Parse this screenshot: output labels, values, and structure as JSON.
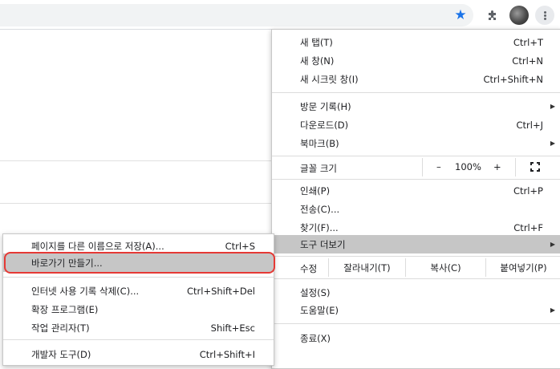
{
  "toolbar": {
    "star_icon": "star-icon",
    "extensions_icon": "puzzle-icon",
    "profile_icon": "avatar",
    "menu_icon": "kebab-menu-icon",
    "accent_color": "#1a73e8"
  },
  "main_menu": {
    "new_tab": {
      "label": "새 탭(T)",
      "shortcut": "Ctrl+T"
    },
    "new_window": {
      "label": "새 창(N)",
      "shortcut": "Ctrl+N"
    },
    "new_incognito": {
      "label": "새 시크릿 창(I)",
      "shortcut": "Ctrl+Shift+N"
    },
    "history": {
      "label": "방문 기록(H)"
    },
    "downloads": {
      "label": "다운로드(D)",
      "shortcut": "Ctrl+J"
    },
    "bookmarks": {
      "label": "북마크(B)"
    },
    "zoom": {
      "label": "글꼴 크기",
      "minus": "–",
      "value": "100%",
      "plus": "+"
    },
    "print": {
      "label": "인쇄(P)",
      "shortcut": "Ctrl+P"
    },
    "cast": {
      "label": "전송(C)..."
    },
    "find": {
      "label": "찾기(F)...",
      "shortcut": "Ctrl+F"
    },
    "more_tools": {
      "label": "도구 더보기"
    },
    "edit": {
      "label": "수정",
      "cut": "잘라내기(T)",
      "copy": "복사(C)",
      "paste": "붙여넣기(P)"
    },
    "settings": {
      "label": "설정(S)"
    },
    "help": {
      "label": "도움말(E)"
    },
    "exit": {
      "label": "종료(X)"
    }
  },
  "sub_menu": {
    "save_page": {
      "label": "페이지를 다른 이름으로 저장(A)...",
      "shortcut": "Ctrl+S"
    },
    "create_shortcut": {
      "label": "바로가기 만들기..."
    },
    "clear_browsing": {
      "label": "인터넷 사용 기록 삭제(C)...",
      "shortcut": "Ctrl+Shift+Del"
    },
    "extensions": {
      "label": "확장 프로그램(E)"
    },
    "task_manager": {
      "label": "작업 관리자(T)",
      "shortcut": "Shift+Esc"
    },
    "dev_tools": {
      "label": "개발자 도구(D)",
      "shortcut": "Ctrl+Shift+I"
    },
    "highlight_color": "#e53935"
  }
}
